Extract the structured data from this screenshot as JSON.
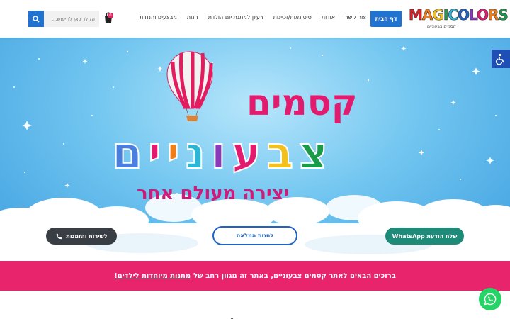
{
  "header": {
    "logo_text": "MAGICOLORS",
    "logo_subtitle": "קסמים צבעוניים",
    "home_label": "דף הבית",
    "nav": [
      "מבצעים והנחות",
      "חנות",
      "רעיון למתנת יום הולדת",
      "סיטונאות/זכיינות",
      "אודות",
      "צור קשר"
    ],
    "cart_count": "0",
    "search_placeholder": "הקלד כאן לחיפוש..."
  },
  "hero": {
    "title_line1": "קסמים",
    "title_line2_letters": [
      "צ",
      "ב",
      "ע",
      "ו",
      "נ",
      "י",
      "י",
      "ם"
    ],
    "title_line3": "יצירה מעולם אחר",
    "whatsapp_button": "שלח הודעת WhatsApp",
    "shop_button": "לחנות המלאה",
    "services_button": "לשירות והזמנות"
  },
  "banner": {
    "text": "ברוכים הבאים לאתר קסמים צבעוניים, באתר זה מגוון רחב של",
    "link": "מתנות מיוחדות לילדים!"
  },
  "colors": {
    "brand_blue": "#2173cf",
    "pink": "#e8246d",
    "whatsapp_green": "#25d366",
    "letters": [
      "#1a9b4a",
      "#f2c11d",
      "#e31b6f",
      "#8a3ab9",
      "#2bb6d8",
      "#f07c1b",
      "#e31b6f",
      "#4a7fe0"
    ]
  }
}
